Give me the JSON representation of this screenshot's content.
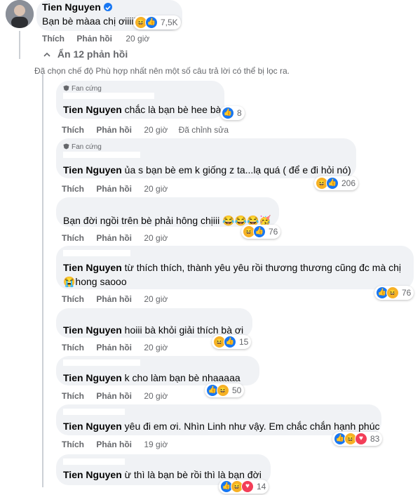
{
  "top_comment": {
    "author": "Tien Nguyen",
    "text": "Bạn bè màaa chị ơiiiii",
    "reaction_count": "7,5K",
    "like_label": "Thích",
    "reply_label": "Phản hồi",
    "time": "20 giờ"
  },
  "hide_replies": "Ẩn 12 phản hồi",
  "filter_notice": "Đã chọn chế độ Phù hợp nhất nên một số câu trả lời có thể bị lọc ra.",
  "fan_badge": "Fan cứng",
  "action_labels": {
    "like": "Thích",
    "reply": "Phản hồi",
    "edited": "Đã chỉnh sửa"
  },
  "replies": [
    {
      "mention": "Tien Nguyen",
      "text": " chắc là bạn bè hee bà",
      "time": "20 giờ",
      "count": "8"
    },
    {
      "mention": "Tien Nguyen",
      "text": " ủa s bạn bè em k giống z ta...lạ quá ( để e đi hỏi nó)",
      "time": "20 giờ",
      "count": "206"
    },
    {
      "mention": "",
      "text": "Bạn đời ngồi trên bè phải hông chịiii 😂😂😂🥳",
      "time": "20 giờ",
      "count": "76"
    },
    {
      "mention": "Tien Nguyen",
      "text": " từ thích thích, thành yêu yêu rồi thương thương cũng đc mà chị",
      "text2": "😭hong saooo",
      "time": "20 giờ",
      "count": "76"
    },
    {
      "mention": "Tien Nguyen",
      "text": " hoiii bà khỏi giải thích bà ơi",
      "time": "20 giờ",
      "count": "15"
    },
    {
      "mention": "Tien Nguyen",
      "text": " k cho làm bạn bè nhaaaaa",
      "time": "20 giờ",
      "count": "50"
    },
    {
      "mention": "Tien Nguyen",
      "text": " yêu đi em ơi. Nhìn Linh như vậy. Em chắc chắn hạnh phúc",
      "time": "19 giờ",
      "count": "83"
    },
    {
      "mention": "Tien Nguyen",
      "text": " ừ thì là bạn bè rồi thì là bạn đời",
      "time": "19 giờ",
      "count": "14"
    }
  ],
  "colors": {
    "bubble": "#f0f2f5",
    "mention": "#050505",
    "meta": "#65676b",
    "like": "#1877f2",
    "haha": "#f7b125",
    "love": "#f33e58"
  }
}
